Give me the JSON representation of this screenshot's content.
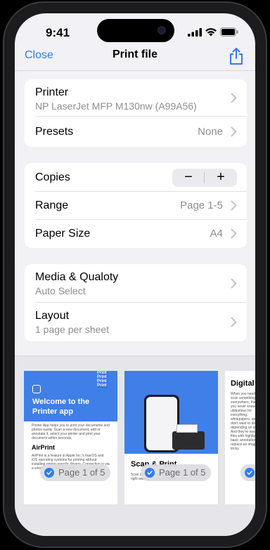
{
  "status_bar": {
    "time": "9:41"
  },
  "nav": {
    "close_label": "Close",
    "title": "Print file"
  },
  "printer_group": {
    "printer_label": "Printer",
    "printer_name": "NP LaserJet MFP M130nw (A99A56)",
    "presets_label": "Presets",
    "presets_value": "None"
  },
  "copies_group": {
    "copies_label": "Copies",
    "minus_label": "−",
    "plus_label": "+",
    "range_label": "Range",
    "range_value": "Page 1-5",
    "paper_label": "Paper Size",
    "paper_value": "A4"
  },
  "media_group": {
    "media_label": "Media & Qualoty",
    "media_value": "Auto Select",
    "layout_label": "Layout",
    "layout_value": "1 page per sheet"
  },
  "preview": {
    "pages": [
      {
        "title": "Welcome to the Printer app",
        "stack_label": "Print Print Print Print",
        "intro": "Printer App helps you to print your documents and photos easily. Scan a new document, edit or annotate it, select your printer and print your document within seconds.",
        "heading": "AirPrint",
        "body": "AirPrint is a feature in Apple Inc.'s macOS and iOS operating systems for printing without installing printer-specific drivers. Connection is via a wireless LAN (Wi-Fi), with...",
        "pill": "Page 1 of 5"
      },
      {
        "title": "Scan & Print",
        "body": "Scan documents with the camera and print them right away from your iPhone.",
        "pill": "Page 1 of 5"
      },
      {
        "title": "Digital S",
        "body": "When you need to scan something everywhere, the file, you never know what ubiquitous for everything, whitepapers, and you don't want to do depending on quality. And they're easy PDF files with highlight text, basic annotation, replace an image get tricky.",
        "pill": ""
      }
    ]
  },
  "colors": {
    "accent": "#2f7cf6",
    "preview_blue": "#3f7fe8"
  }
}
